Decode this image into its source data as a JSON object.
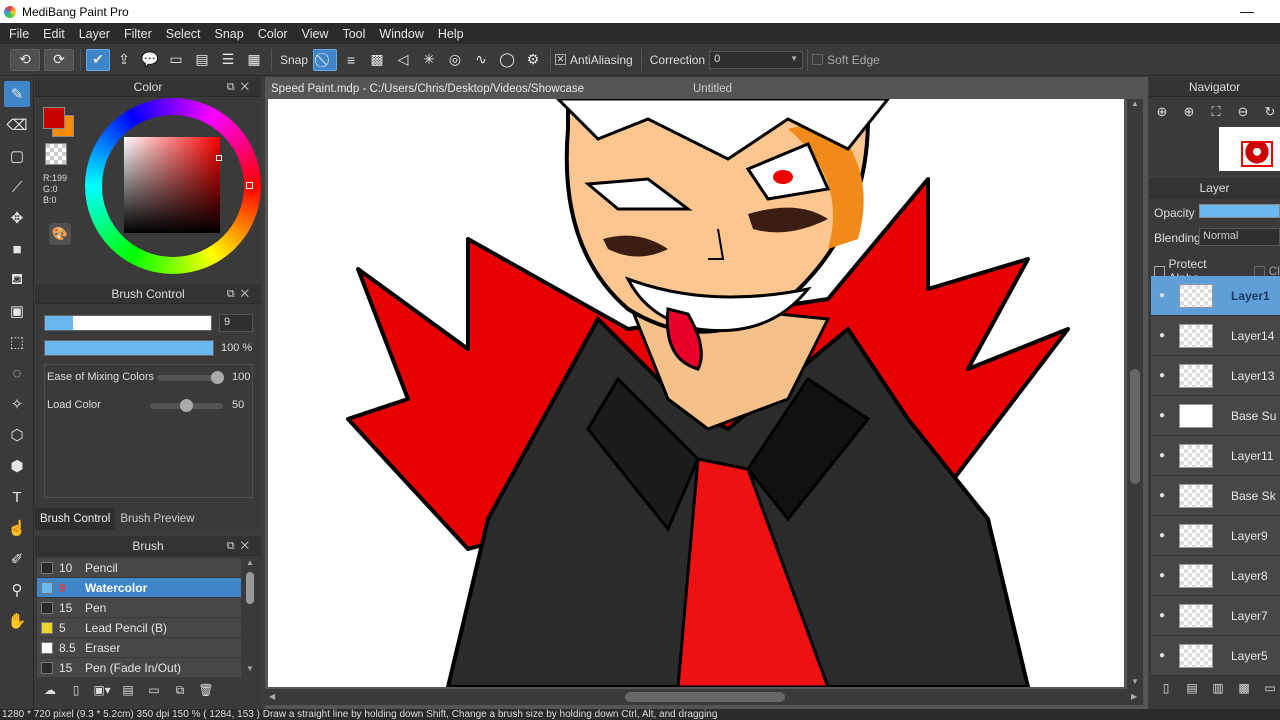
{
  "app": {
    "title": "MediBang Paint Pro",
    "minimize_glyph": "—"
  },
  "menu": [
    "File",
    "Edit",
    "Layer",
    "Filter",
    "Select",
    "Snap",
    "Color",
    "View",
    "Tool",
    "Window",
    "Help"
  ],
  "toolbar": {
    "snap_label": "Snap",
    "antialiasing_label": "AntiAliasing",
    "antialiasing_checked": "✕",
    "correction_label": "Correction",
    "correction_value": "0",
    "soft_edge_label": "Soft Edge"
  },
  "color_panel": {
    "title": "Color",
    "r_label": "R:199",
    "g_label": "G:0",
    "b_label": "B:0",
    "main_color": "#c70000",
    "sub_color": "#ff8c00"
  },
  "brush_control": {
    "title": "Brush Control",
    "size_value": "9",
    "size_fraction": 0.17,
    "opacity_value": "100 %",
    "opacity_fraction": 1.0,
    "ease_mixing_label": "Ease of Mixing Colors",
    "ease_mixing_value": "100",
    "load_color_label": "Load Color",
    "load_color_value": "50",
    "tabs": [
      "Brush Control",
      "Brush Preview"
    ]
  },
  "brush_panel": {
    "title": "Brush",
    "items": [
      {
        "size": "10",
        "name": "Pencil",
        "color": "#2a2a2a"
      },
      {
        "size": "9",
        "name": "Watercolor",
        "color": "#6bb8f0"
      },
      {
        "size": "15",
        "name": "Pen",
        "color": "#2a2a2a"
      },
      {
        "size": "5",
        "name": "Lead Pencil (B)",
        "color": "#e8d62c"
      },
      {
        "size": "8.5",
        "name": "Eraser",
        "color": "#ffffff"
      },
      {
        "size": "15",
        "name": "Pen (Fade In/Out)",
        "color": "#2a2a2a"
      }
    ]
  },
  "canvas": {
    "tab_file": "Speed Paint.mdp - C:/Users/Chris/Desktop/Videos/Showcase",
    "tab_untitled": "Untitled"
  },
  "navigator": {
    "title": "Navigator"
  },
  "layer_panel": {
    "title": "Layer",
    "opacity_label": "Opacity",
    "blending_label": "Blending",
    "blending_value": "Normal",
    "protect_alpha_label": "Protect Alpha",
    "clipping_label": "Cl",
    "layers": [
      "Layer1",
      "Layer14",
      "Layer13",
      "Base Su",
      "Layer11",
      "Base Sk",
      "Layer9",
      "Layer8",
      "Layer7",
      "Layer5"
    ]
  },
  "statusbar": {
    "text": "1280 * 720 pixel   (9.3 * 5.2cm)   350 dpi   150 %   ( 1284, 153 )   Draw a straight line by holding down Shift, Change a brush size by holding down Ctrl, Alt, and dragging"
  }
}
